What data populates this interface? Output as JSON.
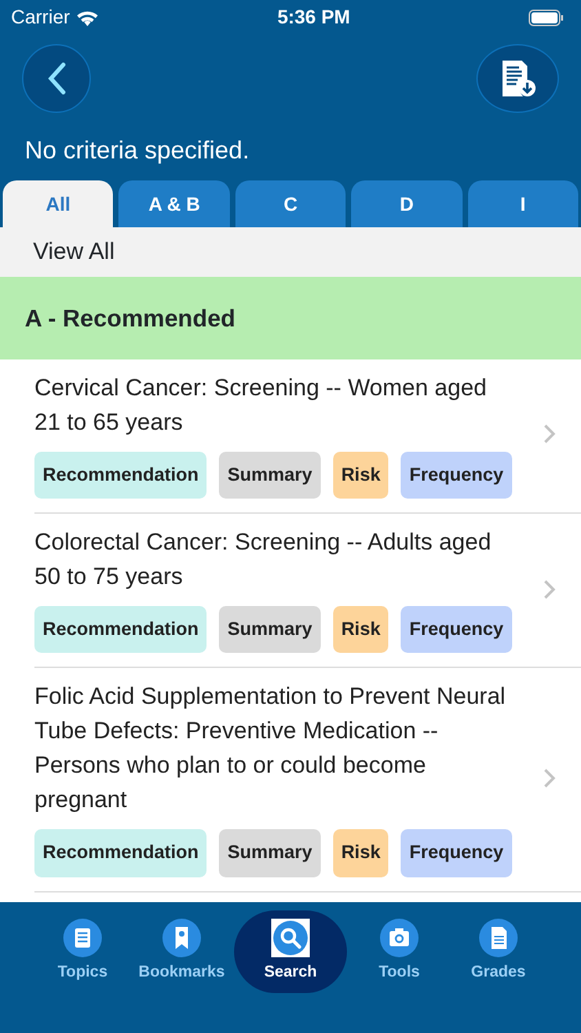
{
  "status_bar": {
    "carrier": "Carrier",
    "time": "5:36 PM"
  },
  "header": {
    "criteria": "No criteria specified."
  },
  "tabs": [
    {
      "label": "All",
      "selected": true
    },
    {
      "label": "A & B",
      "selected": false
    },
    {
      "label": "C",
      "selected": false
    },
    {
      "label": "D",
      "selected": false
    },
    {
      "label": "I",
      "selected": false
    }
  ],
  "view_all": "View All",
  "section": {
    "title": "A - Recommended"
  },
  "items": [
    {
      "title": "Cervical Cancer: Screening -- Women aged 21 to 65 years",
      "tags": [
        {
          "kind": "recommendation",
          "label": "Recommendation"
        },
        {
          "kind": "summary",
          "label": "Summary"
        },
        {
          "kind": "risk",
          "label": "Risk"
        },
        {
          "kind": "frequency",
          "label": "Frequency"
        }
      ]
    },
    {
      "title": "Colorectal Cancer: Screening -- Adults aged 50 to 75 years",
      "tags": [
        {
          "kind": "recommendation",
          "label": "Recommendation"
        },
        {
          "kind": "summary",
          "label": "Summary"
        },
        {
          "kind": "risk",
          "label": "Risk"
        },
        {
          "kind": "frequency",
          "label": "Frequency"
        }
      ]
    },
    {
      "title": "Folic Acid Supplementation to Prevent Neural Tube Defects: Preventive Medication -- Persons who plan to or could become pregnant",
      "tags": [
        {
          "kind": "recommendation",
          "label": "Recommendation"
        },
        {
          "kind": "summary",
          "label": "Summary"
        },
        {
          "kind": "risk",
          "label": "Risk"
        },
        {
          "kind": "frequency",
          "label": "Frequency"
        }
      ]
    }
  ],
  "tab_bar": [
    {
      "kind": "topics",
      "label": "Topics",
      "selected": false
    },
    {
      "kind": "bookmarks",
      "label": "Bookmarks",
      "selected": false
    },
    {
      "kind": "search",
      "label": "Search",
      "selected": true
    },
    {
      "kind": "tools",
      "label": "Tools",
      "selected": false
    },
    {
      "kind": "grades",
      "label": "Grades",
      "selected": false
    }
  ]
}
